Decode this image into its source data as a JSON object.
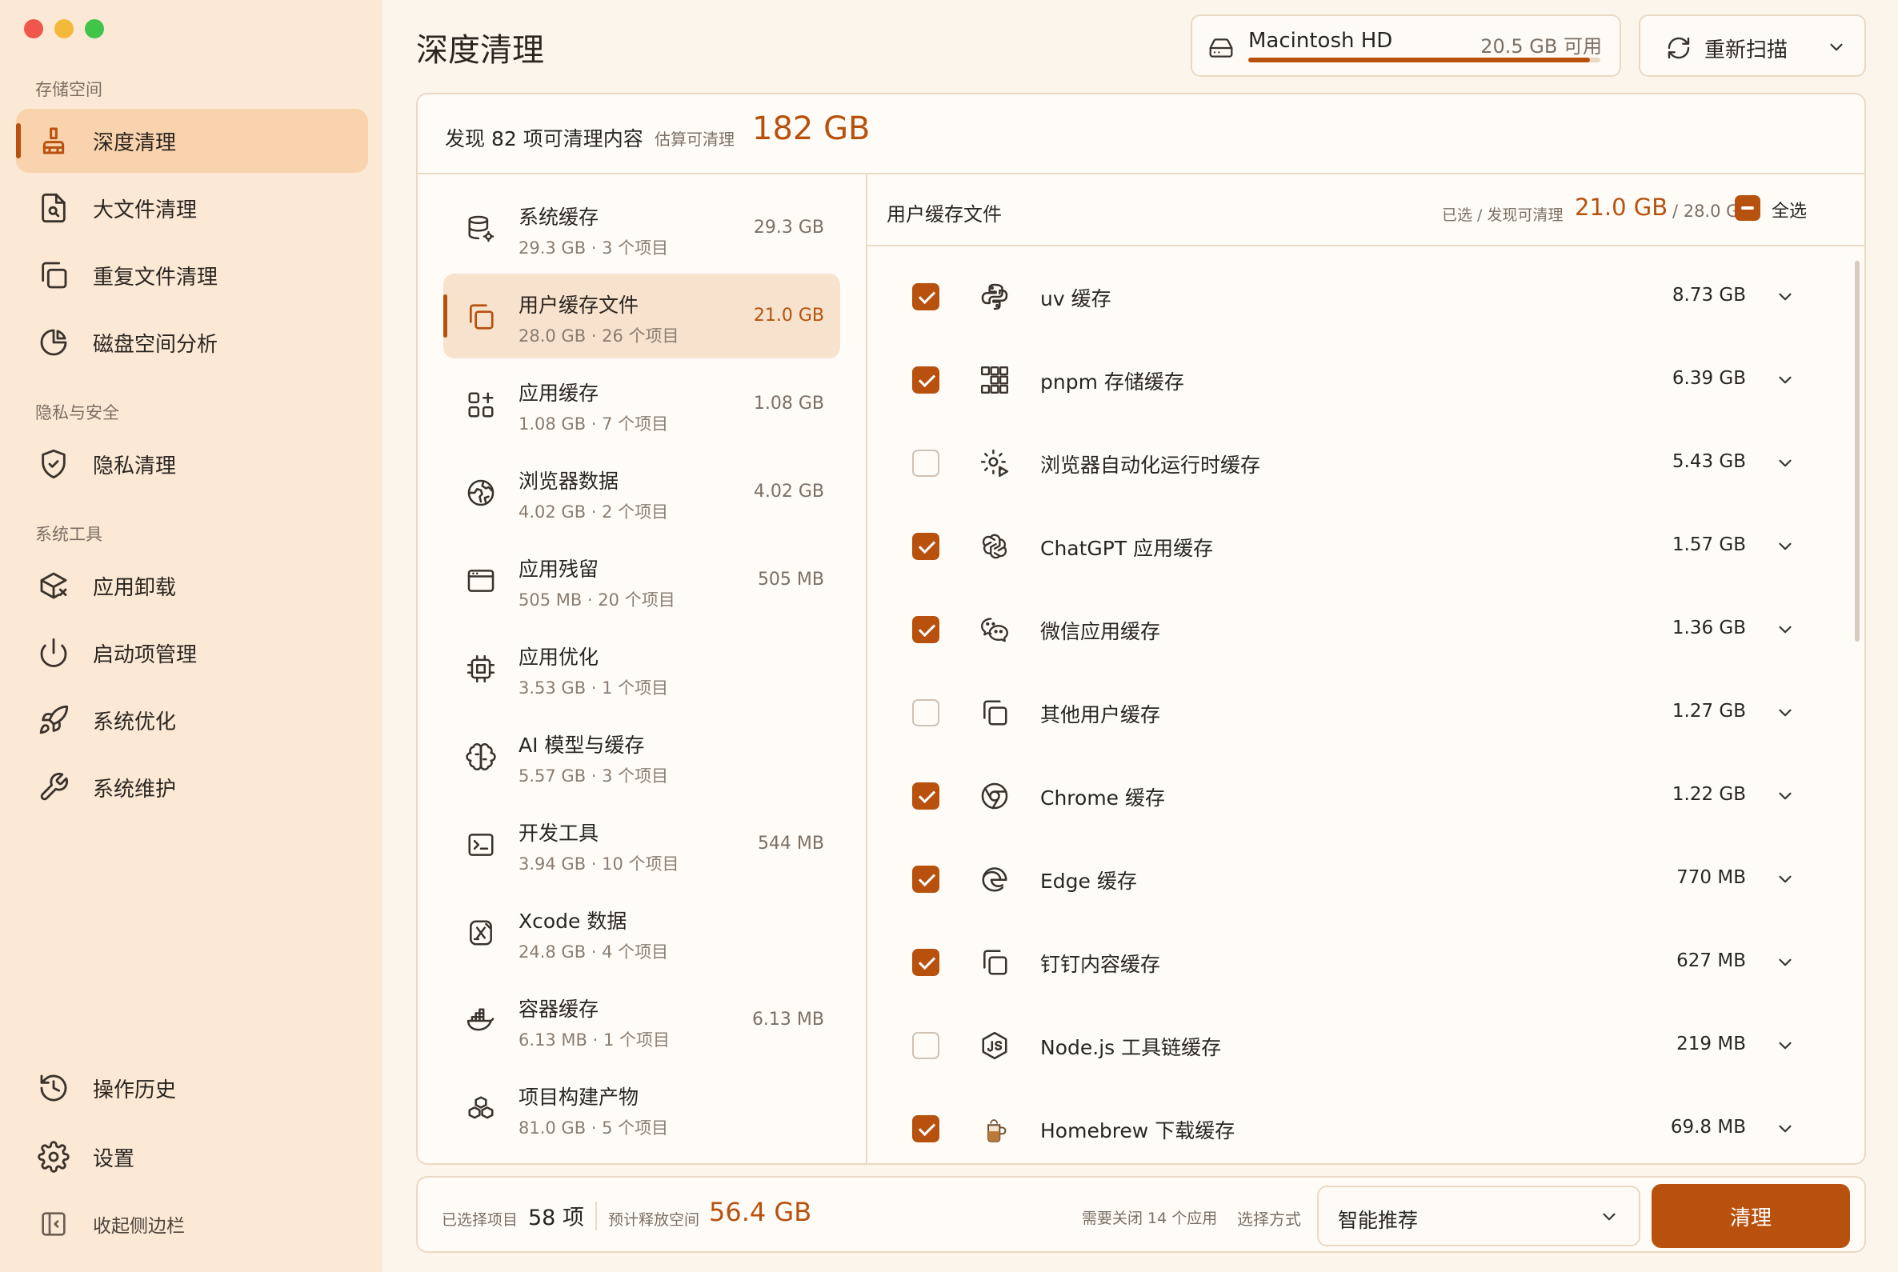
{
  "sidebar": {
    "sections": [
      "存储空间",
      "隐私与安全",
      "系统工具"
    ],
    "items": [
      {
        "label": "深度清理",
        "icon": "broom-icon",
        "active": true
      },
      {
        "label": "大文件清理",
        "icon": "file-search-icon"
      },
      {
        "label": "重复文件清理",
        "icon": "copy-icon"
      },
      {
        "label": "磁盘空间分析",
        "icon": "pie-chart-icon"
      },
      {
        "label": "隐私清理",
        "icon": "shield-check-icon"
      },
      {
        "label": "应用卸载",
        "icon": "package-x-icon"
      },
      {
        "label": "启动项管理",
        "icon": "power-icon"
      },
      {
        "label": "系统优化",
        "icon": "rocket-icon"
      },
      {
        "label": "系统维护",
        "icon": "wrench-icon"
      },
      {
        "label": "操作历史",
        "icon": "history-icon"
      },
      {
        "label": "设置",
        "icon": "gear-icon"
      },
      {
        "label": "收起侧边栏",
        "icon": "sidebar-collapse-icon"
      }
    ]
  },
  "header": {
    "title": "深度清理",
    "disk": {
      "name": "Macintosh HD",
      "free": "20.5 GB 可用",
      "used_fraction": 0.97
    },
    "rescan_label": "重新扫描"
  },
  "summary": {
    "found": "发现 82 项可清理内容",
    "est_label": "估算可清理",
    "est_size": "182 GB"
  },
  "categories": [
    {
      "name": "系统缓存",
      "sub": "29.3 GB · 3 个项目",
      "size": "29.3 GB",
      "icon": "database-gear-icon"
    },
    {
      "name": "用户缓存文件",
      "sub": "28.0 GB · 26 个项目",
      "size": "21.0 GB",
      "icon": "copy-icon",
      "active": true
    },
    {
      "name": "应用缓存",
      "sub": "1.08 GB · 7 个项目",
      "size": "1.08 GB",
      "icon": "apps-plus-icon"
    },
    {
      "name": "浏览器数据",
      "sub": "4.02 GB · 2 个项目",
      "size": "4.02 GB",
      "icon": "globe-icon"
    },
    {
      "name": "应用残留",
      "sub": "505 MB · 20 个项目",
      "size": "505 MB",
      "icon": "window-icon"
    },
    {
      "name": "应用优化",
      "sub": "3.53 GB · 1 个项目",
      "size": "",
      "icon": "cpu-icon"
    },
    {
      "name": "AI 模型与缓存",
      "sub": "5.57 GB · 3 个项目",
      "size": "",
      "icon": "brain-icon"
    },
    {
      "name": "开发工具",
      "sub": "3.94 GB · 10 个项目",
      "size": "544 MB",
      "icon": "terminal-icon"
    },
    {
      "name": "Xcode 数据",
      "sub": "24.8 GB · 4 个项目",
      "size": "",
      "icon": "xcode-icon"
    },
    {
      "name": "容器缓存",
      "sub": "6.13 MB · 1 个项目",
      "size": "6.13 MB",
      "icon": "docker-icon"
    },
    {
      "name": "项目构建产物",
      "sub": "81.0 GB · 5 个项目",
      "size": "",
      "icon": "boxes-icon"
    }
  ],
  "detail": {
    "title": "用户缓存文件",
    "selected_label": "已选 / 发现可清理",
    "selected_size": "21.0 GB",
    "total": "/ 28.0 GB",
    "select_all": "全选",
    "rows": [
      {
        "label": "uv 缓存",
        "size": "8.73 GB",
        "checked": true,
        "icon": "python-icon"
      },
      {
        "label": "pnpm 存储缓存",
        "size": "6.39 GB",
        "checked": true,
        "icon": "pnpm-icon"
      },
      {
        "label": "浏览器自动化运行时缓存",
        "size": "5.43 GB",
        "checked": false,
        "icon": "gear-play-icon"
      },
      {
        "label": "ChatGPT 应用缓存",
        "size": "1.57 GB",
        "checked": true,
        "icon": "openai-icon"
      },
      {
        "label": "微信应用缓存",
        "size": "1.36 GB",
        "checked": true,
        "icon": "wechat-icon"
      },
      {
        "label": "其他用户缓存",
        "size": "1.27 GB",
        "checked": false,
        "icon": "copy-icon"
      },
      {
        "label": "Chrome 缓存",
        "size": "1.22 GB",
        "checked": true,
        "icon": "chrome-icon"
      },
      {
        "label": "Edge 缓存",
        "size": "770 MB",
        "checked": true,
        "icon": "edge-icon"
      },
      {
        "label": "钉钉内容缓存",
        "size": "627 MB",
        "checked": true,
        "icon": "copy-icon"
      },
      {
        "label": "Node.js 工具链缓存",
        "size": "219 MB",
        "checked": false,
        "icon": "nodejs-icon"
      },
      {
        "label": "Homebrew 下载缓存",
        "size": "69.8 MB",
        "checked": true,
        "icon": "homebrew-icon"
      }
    ]
  },
  "footer": {
    "selected_label": "已选择项目",
    "selected_value": "58 项",
    "free_label": "预计释放空间",
    "free_value": "56.4 GB",
    "close_apps": "需要关闭 14 个应用",
    "mode_label": "选择方式",
    "mode_value": "智能推荐",
    "clean_label": "清理"
  },
  "colors": {
    "accent": "#b8510d",
    "sidebar_bg": "#fbe9d6",
    "active_bg": "#f9d3ad",
    "border": "#ead9c4"
  }
}
